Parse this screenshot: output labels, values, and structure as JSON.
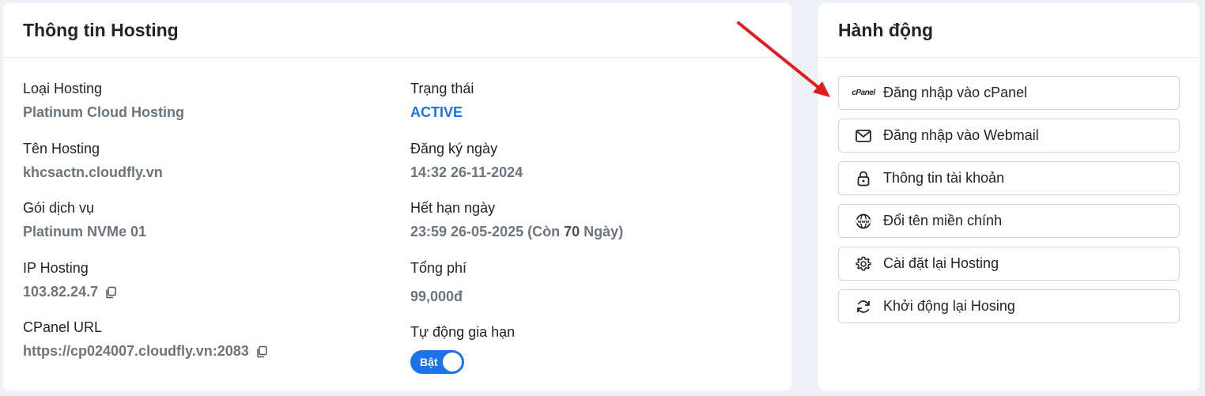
{
  "info": {
    "title": "Thông tin Hosting",
    "left": [
      {
        "label": "Loại Hosting",
        "value": "Platinum Cloud Hosting"
      },
      {
        "label": "Tên Hosting",
        "value": "khcsactn.cloudfly.vn"
      },
      {
        "label": "Gói dịch vụ",
        "value": "Platinum NVMe 01"
      },
      {
        "label": "IP Hosting",
        "value": "103.82.24.7"
      },
      {
        "label": "CPanel URL",
        "value": "https://cp024007.cloudfly.vn:2083"
      }
    ],
    "right": {
      "status_label": "Trạng thái",
      "status_value": "ACTIVE",
      "registered_label": "Đăng ký ngày",
      "registered_value": "14:32 26-11-2024",
      "expires_label": "Hết hạn ngày",
      "expires_prefix": "23:59 26-05-2025 (Còn",
      "expires_days": "70",
      "expires_suffix": "Ngày)",
      "total_label": "Tổng phí",
      "total_value": "99,000đ",
      "autorenew_label": "Tự động gia hạn",
      "autorenew_toggle": "Bật"
    }
  },
  "actions": {
    "title": "Hành động",
    "cpanel_logo_text": "cPanel",
    "items": [
      {
        "label": "Đăng nhập vào cPanel",
        "icon": "cpanel-icon"
      },
      {
        "label": "Đăng nhập vào Webmail",
        "icon": "mail-icon"
      },
      {
        "label": "Thông tin tài khoản",
        "icon": "lock-icon"
      },
      {
        "label": "Đổi tên miền chính",
        "icon": "www-globe-icon"
      },
      {
        "label": "Cài đặt lại Hosting",
        "icon": "gear-icon"
      },
      {
        "label": "Khởi động lại Hosing",
        "icon": "refresh-icon"
      }
    ]
  },
  "colors": {
    "accent": "#1a73e8",
    "annotation_arrow": "#e11d1d"
  }
}
